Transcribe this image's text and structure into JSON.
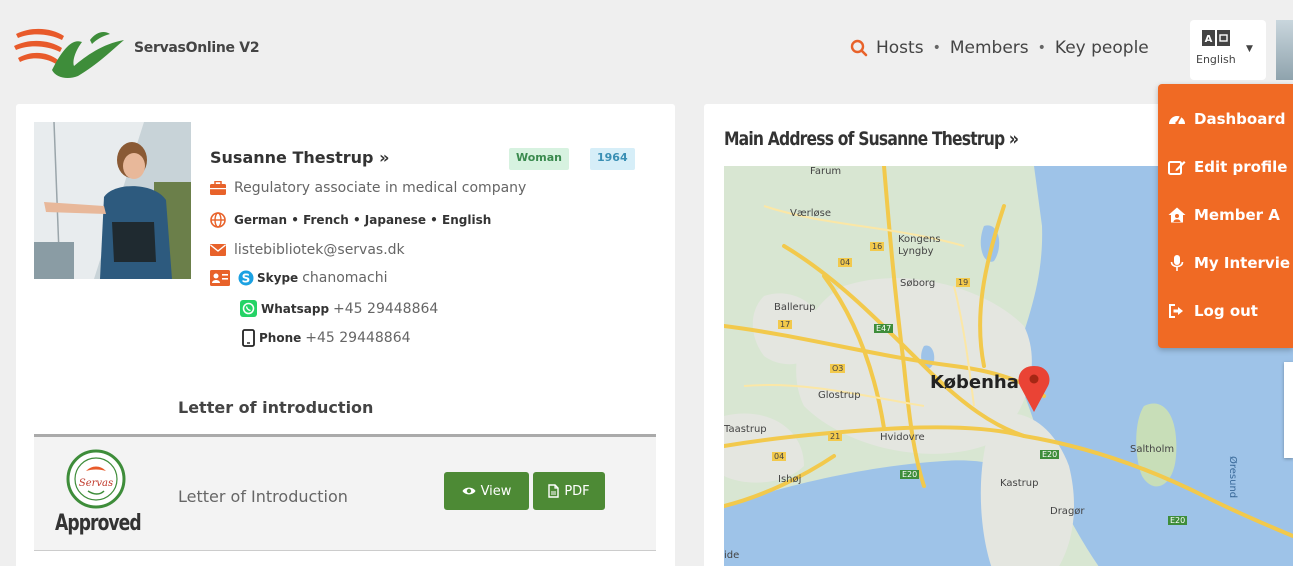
{
  "header": {
    "brand": "ServasOnline V2",
    "nav": {
      "hosts": "Hosts",
      "members": "Members",
      "key_people": "Key people"
    },
    "language": "English"
  },
  "profile": {
    "name": "Susanne Thestrup »",
    "gender": "Woman",
    "birth_year": "1964",
    "occupation": "Regulatory associate in medical company",
    "languages": "German • French • Japanese • English",
    "email": "listebibliotek@servas.dk",
    "skype_label": "Skype",
    "skype": "chanomachi",
    "whatsapp_label": "Whatsapp",
    "whatsapp": "+45 29448864",
    "phone_label": "Phone",
    "phone": "+45 29448864"
  },
  "letter": {
    "heading": "Letter of introduction",
    "status": "Approved",
    "seal_text": "Servas",
    "row_label": "Letter of Introduction",
    "view_label": "View",
    "pdf_label": "PDF"
  },
  "map": {
    "title": "Main Address of Susanne Thestrup »",
    "labels": {
      "farum": "Farum",
      "vaerlose": "Værløse",
      "kongens_lyngby": "Kongens Lyngby",
      "soborg": "Søborg",
      "ballerup": "Ballerup",
      "glostrup": "Glostrup",
      "kobenhavn": "Københa",
      "taastrup": "Taastrup",
      "hvidovre": "Hvidovre",
      "ishoj": "Ishøj",
      "kastrup": "Kastrup",
      "dragor": "Dragør",
      "saltholm": "Saltholm",
      "oresund": "Øresund",
      "ide": "ide",
      "r16": "16",
      "r04a": "04",
      "r19": "19",
      "r17": "17",
      "e47": "E47",
      "o3": "O3",
      "r21": "21",
      "r04b": "04",
      "e20a": "E20",
      "e20b": "E20",
      "e20c": "E20"
    }
  },
  "user_menu": {
    "items": [
      "Dashboard",
      "Edit profile",
      "Member A",
      "My Intervie",
      "Log out"
    ]
  },
  "colors": {
    "accent_orange": "#f06a24",
    "button_green": "#4d8a35",
    "badge_green_bg": "#d7f2e0",
    "badge_blue_bg": "#d6eef8"
  }
}
